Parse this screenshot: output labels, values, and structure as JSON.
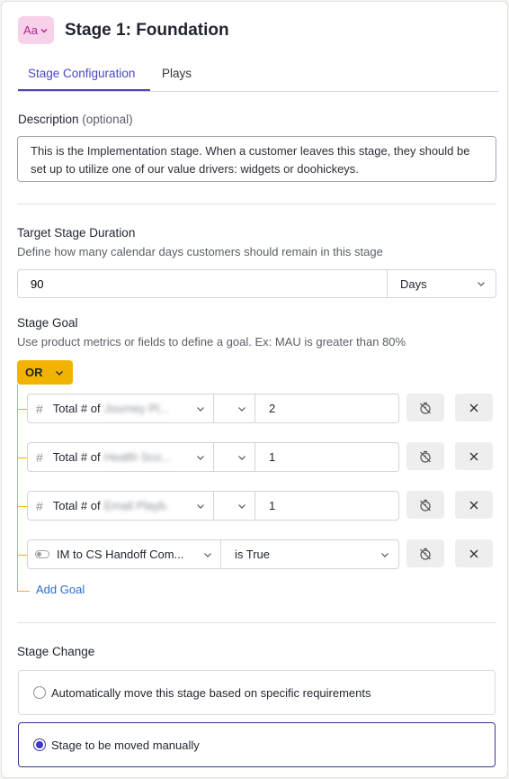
{
  "header": {
    "icon_text": "Aa",
    "title": "Stage 1: Foundation"
  },
  "tabs": [
    {
      "label": "Stage Configuration",
      "active": true
    },
    {
      "label": "Plays",
      "active": false
    }
  ],
  "description": {
    "label": "Description",
    "optional": "(optional)",
    "value": "This is the Implementation stage. When a customer leaves this stage, they should be set up to utilize one of our value drivers: widgets or doohickeys."
  },
  "duration": {
    "label": "Target Stage Duration",
    "help": "Define how many calendar days customers should remain in this stage",
    "value": "90",
    "unit": "Days"
  },
  "goal": {
    "label": "Stage Goal",
    "help": "Use product metrics or fields to define a goal. Ex: MAU is greater than 80%",
    "operator": "OR",
    "rows": [
      {
        "prefix": "Total # of",
        "blurred": "Journey Pl...",
        "value": "2"
      },
      {
        "prefix": "Total # of",
        "blurred": "Health Sco...",
        "value": "1"
      },
      {
        "prefix": "Total # of",
        "blurred": "Email Playb.",
        "value": "1"
      }
    ],
    "toggle_row": {
      "field": "IM to CS Handoff Com...",
      "condition": "is True"
    },
    "add_label": "Add Goal"
  },
  "stage_change": {
    "label": "Stage Change",
    "options": [
      {
        "label": "Automatically move this stage based on specific requirements",
        "selected": false
      },
      {
        "label": "Stage to be moved manually",
        "selected": true
      }
    ]
  },
  "colors": {
    "accent": "#4a46c4",
    "operator_bg": "#f2b300",
    "link": "#2a6cc9",
    "icon_bg": "#f7d0e9"
  }
}
